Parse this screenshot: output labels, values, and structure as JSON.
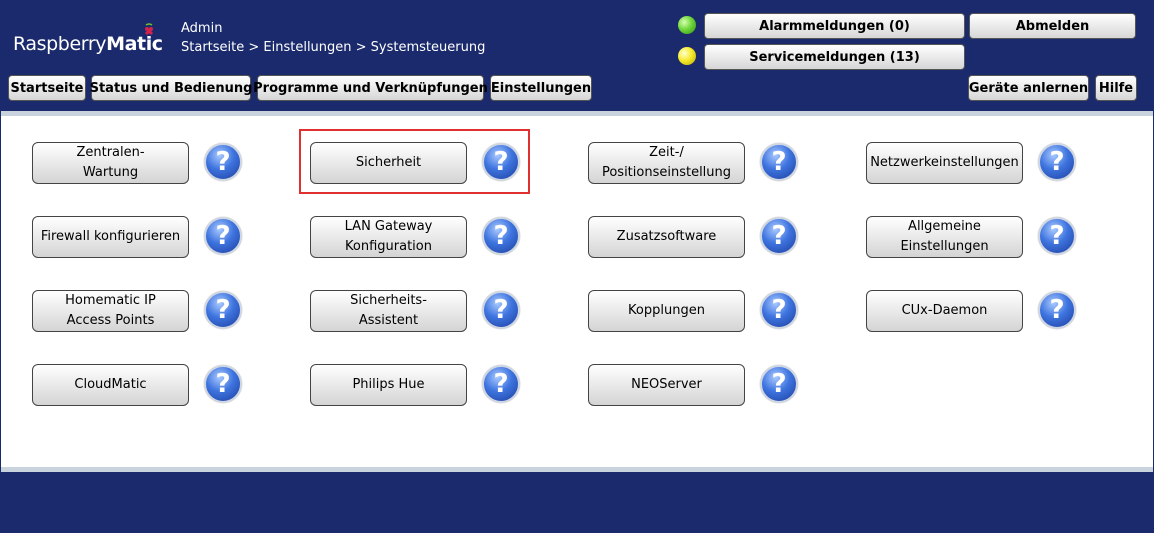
{
  "header": {
    "logo_prefix": "Raspberry",
    "logo_suffix": "Matic",
    "user": "Admin",
    "breadcrumb": "Startseite > Einstellungen > Systemsteuerung",
    "alarm_button": "Alarmmeldungen (0)",
    "service_button": "Servicemeldungen (13)",
    "logout_button": "Abmelden",
    "alarm_status_color": "#5fd234",
    "service_status_color": "#f1e52a"
  },
  "nav": {
    "items": [
      "Startseite",
      "Status und Bedienung",
      "Programme und Verknüpfungen",
      "Einstellungen"
    ],
    "right_items": [
      "Geräte anlernen",
      "Hilfe"
    ]
  },
  "tiles": [
    {
      "label": "Zentralen-\nWartung",
      "help": "?"
    },
    {
      "label": "Sicherheit",
      "help": "?",
      "highlighted": true
    },
    {
      "label": "Zeit-/\nPositionseinstellung",
      "help": "?"
    },
    {
      "label": "Netzwerkeinstellungen",
      "help": "?"
    },
    {
      "label": "Firewall konfigurieren",
      "help": "?"
    },
    {
      "label": "LAN Gateway\nKonfiguration",
      "help": "?"
    },
    {
      "label": "Zusatzsoftware",
      "help": "?"
    },
    {
      "label": "Allgemeine\nEinstellungen",
      "help": "?"
    },
    {
      "label": "Homematic IP\nAccess Points",
      "help": "?"
    },
    {
      "label": "Sicherheits-\nAssistent",
      "help": "?"
    },
    {
      "label": "Kopplungen",
      "help": "?"
    },
    {
      "label": "CUx-Daemon",
      "help": "?"
    },
    {
      "label": "CloudMatic",
      "help": "?"
    },
    {
      "label": "Philips Hue",
      "help": "?"
    },
    {
      "label": "NEOServer",
      "help": "?"
    }
  ],
  "colors": {
    "header_bg": "#1a2a6c",
    "highlight_border": "#e03030"
  }
}
